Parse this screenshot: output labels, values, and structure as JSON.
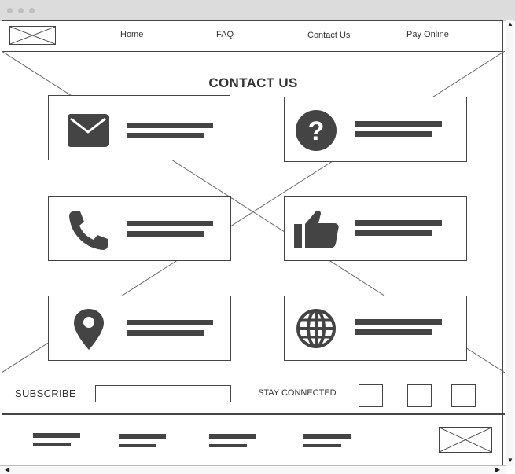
{
  "nav": {
    "items": [
      {
        "label": "Home"
      },
      {
        "label": "FAQ"
      },
      {
        "label": "Contact Us"
      },
      {
        "label": "Pay Online"
      }
    ]
  },
  "main": {
    "title": "CONTACT US",
    "cards": [
      {
        "icon": "envelope-icon"
      },
      {
        "icon": "question-icon"
      },
      {
        "icon": "phone-icon"
      },
      {
        "icon": "thumbs-up-icon"
      },
      {
        "icon": "location-pin-icon"
      },
      {
        "icon": "globe-icon"
      }
    ]
  },
  "subscribe": {
    "label": "SUBSCRIBE",
    "input_value": "",
    "stay_connected": "STAY CONNECTED",
    "social_count": 3
  },
  "colors": {
    "stroke": "#444444",
    "titlebar": "#dcdcdc"
  }
}
